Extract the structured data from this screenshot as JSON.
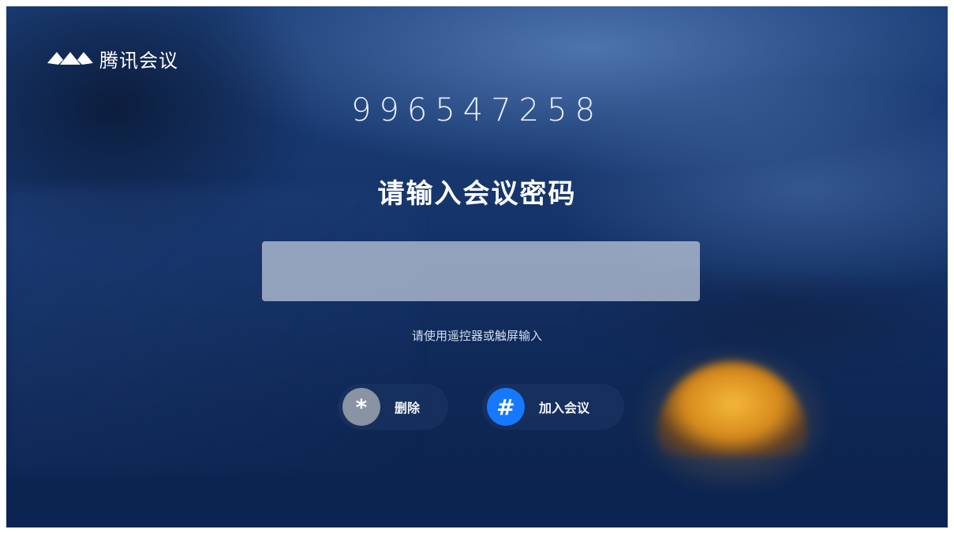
{
  "brand": {
    "logo_icon": "tencent-meeting-logo-icon",
    "name": "腾讯会议"
  },
  "meeting": {
    "id": "996547258"
  },
  "prompt": {
    "title": "请输入会议密码",
    "input_value": "",
    "hint": "请使用遥控器或触屏输入"
  },
  "actions": {
    "delete": {
      "key_symbol": "*",
      "label": "删除",
      "color": "#8a93a3"
    },
    "join": {
      "key_symbol": "#",
      "label": "加入会议",
      "color": "#1677ff"
    }
  }
}
